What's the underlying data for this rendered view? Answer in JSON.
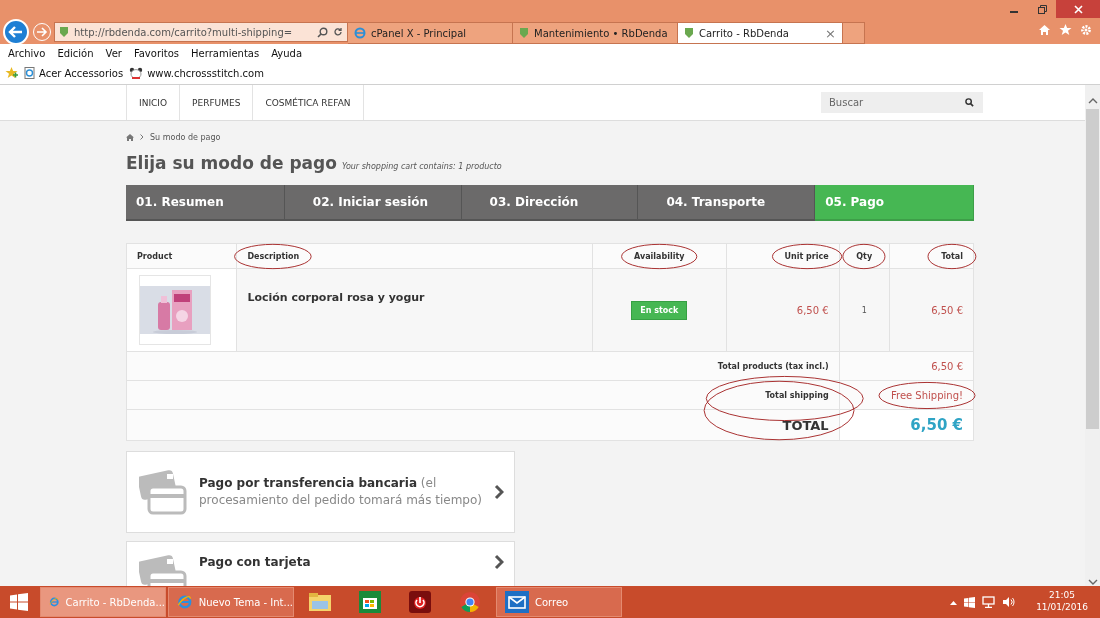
{
  "browser": {
    "address": "http://rbdenda.com/carrito?multi-shipping=",
    "tabs": [
      {
        "title": "cPanel X - Principal",
        "kind": "ie",
        "selected": false
      },
      {
        "title": "Mantenimiento • RbDenda",
        "kind": "site",
        "selected": false
      },
      {
        "title": "Carrito - RbDenda",
        "kind": "site",
        "selected": true,
        "close": "×"
      }
    ],
    "menu": [
      "Archivo",
      "Edición",
      "Ver",
      "Favoritos",
      "Herramientas",
      "Ayuda"
    ],
    "favorites": [
      {
        "label": "Acer Accessorios",
        "kind": "page"
      },
      {
        "label": "www.chcrossstitch.com",
        "kind": "panda"
      }
    ]
  },
  "site_nav": {
    "items": [
      "INICIO",
      "PERFUMES",
      "COSMÉTICA REFAN"
    ],
    "search": {
      "placeholder": "Buscar"
    }
  },
  "breadcrumb": "Su modo de pago",
  "heading": "Elija su modo de pago",
  "subheading": "Your shopping cart contains: 1 producto",
  "steps": [
    {
      "label": "01. Resumen",
      "selected": false
    },
    {
      "label": "02. Iniciar sesión",
      "selected": false
    },
    {
      "label": "03. Dirección",
      "selected": false
    },
    {
      "label": "04. Transporte",
      "selected": false
    },
    {
      "label": "05. Pago",
      "selected": true
    }
  ],
  "table": {
    "columns": [
      {
        "label": "Product"
      },
      {
        "label": "Description",
        "circled": true
      },
      {
        "label": "Availability",
        "circled": true
      },
      {
        "label": "Unit price",
        "circled": true
      },
      {
        "label": "Qty",
        "circled": true
      },
      {
        "label": "Total",
        "circled": true
      }
    ],
    "rows": [
      {
        "description": "Loción corporal rosa y yogur",
        "availability": "En stock",
        "unit_price": "6,50 €",
        "qty": "1",
        "total": "6,50 €"
      }
    ],
    "summary": [
      {
        "label": "Total products (tax incl.)",
        "value": "6,50 €",
        "kind": "line"
      },
      {
        "label": "Total shipping",
        "value": "Free Shipping!",
        "kind": "line",
        "label_circled": true,
        "value_circled": true
      },
      {
        "label": "TOTAL",
        "value": "6,50 €",
        "kind": "grand",
        "label_circled": true
      }
    ]
  },
  "payment_options": [
    {
      "title": "Pago por transferencia bancaria",
      "note": "(el procesamiento del pedido tomará más tiempo)"
    },
    {
      "title": "Pago con tarjeta"
    }
  ],
  "taskbar": {
    "items": [
      {
        "label": "Carrito - RbDenda...",
        "kind": "ie",
        "selected": true
      },
      {
        "label": "Nuevo Tema - Int...",
        "kind": "ie",
        "selected": false
      },
      {
        "kind": "folder",
        "selected": false
      },
      {
        "kind": "store",
        "selected": false
      },
      {
        "kind": "power",
        "selected": false
      },
      {
        "kind": "chrome",
        "selected": false
      },
      {
        "label": "Correo",
        "kind": "mail",
        "selected": false
      }
    ],
    "time": "21:05",
    "date": "11/01/2016"
  }
}
